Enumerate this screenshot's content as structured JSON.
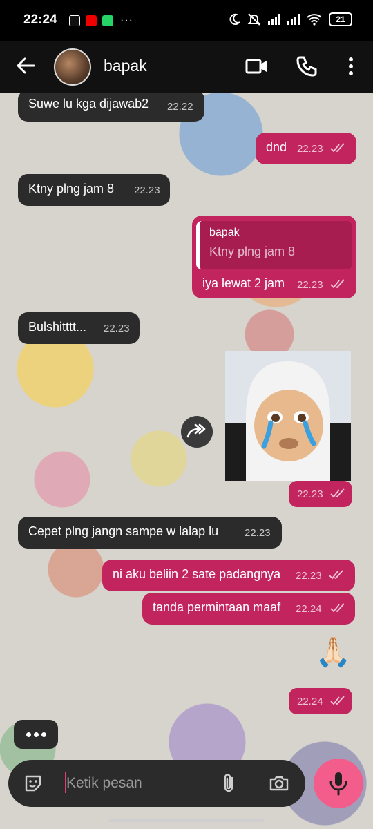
{
  "status_bar": {
    "time": "22:24",
    "more": "···",
    "battery": "21"
  },
  "header": {
    "contact_name": "bapak"
  },
  "messages": [
    {
      "dir": "in",
      "text": "Suwe lu kga dijawab2",
      "time": "22.22"
    },
    {
      "dir": "out",
      "text": "dnd",
      "time": "22.23"
    },
    {
      "dir": "in",
      "text": "Ktny plng jam 8",
      "time": "22.23"
    },
    {
      "dir": "out",
      "reply_to_name": "bapak",
      "reply_to_text": "Ktny plng jam 8",
      "text": "iya lewat 2 jam",
      "time": "22.23"
    },
    {
      "dir": "in",
      "text": "Bulshitttt...",
      "time": "22.23"
    },
    {
      "dir": "out",
      "type": "image",
      "time": "22.23"
    },
    {
      "dir": "in",
      "text": "Cepet plng jangn sampe w lalap lu",
      "time": "22.23"
    },
    {
      "dir": "out",
      "text": "ni aku beliin 2 sate padangnya",
      "time": "22.23"
    },
    {
      "dir": "out",
      "text": "tanda permintaan maaf",
      "time": "22.24"
    },
    {
      "dir": "out",
      "type": "emoji",
      "text": "🙏🏻",
      "time": "22.24"
    }
  ],
  "input": {
    "placeholder": "Ketik pesan"
  },
  "colors": {
    "outgoing": "#c2245e",
    "incoming": "#2b2b2b",
    "mic": "#f25d8b"
  },
  "icons": [
    "back-arrow-icon",
    "video-call-icon",
    "phone-icon",
    "more-options-icon",
    "forward-icon",
    "sticker-icon",
    "attach-icon",
    "camera-icon",
    "mic-icon"
  ]
}
